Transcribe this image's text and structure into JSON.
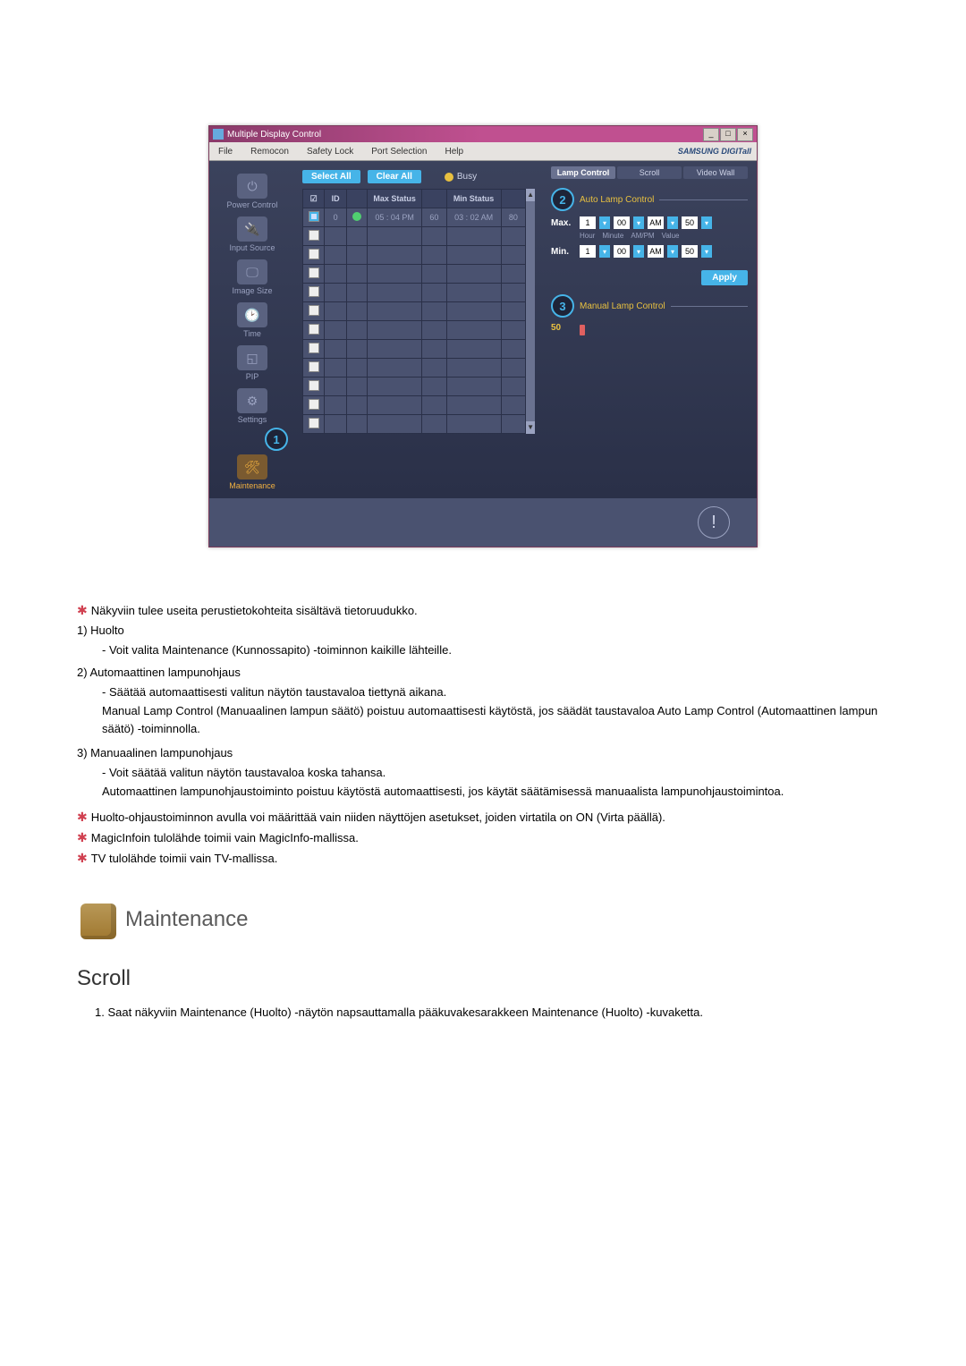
{
  "window": {
    "title": "Multiple Display Control",
    "menu": [
      "File",
      "Remocon",
      "Safety Lock",
      "Port Selection",
      "Help"
    ],
    "brand": "SAMSUNG DIGITall",
    "win_buttons": [
      "_",
      "□",
      "×"
    ]
  },
  "sidebar": {
    "items": [
      {
        "label": "Power Control"
      },
      {
        "label": "Input Source"
      },
      {
        "label": "Image Size"
      },
      {
        "label": "Time"
      },
      {
        "label": "PIP"
      },
      {
        "label": "Settings"
      },
      {
        "label": "Maintenance",
        "active": true
      }
    ],
    "callout": "1"
  },
  "toolbar": {
    "select_all": "Select All",
    "clear_all": "Clear All",
    "busy_label": "Busy"
  },
  "table": {
    "headers": {
      "chk": "☑",
      "id": "ID",
      "status_icon": "●",
      "max": "Max Status",
      "v1": "",
      "min": "Min Status",
      "v2": ""
    },
    "rows": [
      {
        "checked": true,
        "id": "0",
        "status": "green",
        "max": "05 : 04 PM",
        "v1": "60",
        "min": "03 : 02 AM",
        "v2": "80"
      },
      {
        "checked": false
      },
      {
        "checked": false
      },
      {
        "checked": false
      },
      {
        "checked": false
      },
      {
        "checked": false
      },
      {
        "checked": false
      },
      {
        "checked": false
      },
      {
        "checked": false
      },
      {
        "checked": false
      },
      {
        "checked": false
      },
      {
        "checked": false
      }
    ]
  },
  "right": {
    "tabs": [
      {
        "label": "Lamp Control",
        "active": true
      },
      {
        "label": "Scroll",
        "active": false
      },
      {
        "label": "Video Wall",
        "active": false
      }
    ],
    "auto": {
      "callout": "2",
      "title": "Auto Lamp Control",
      "rows": [
        {
          "lbl": "Max.",
          "hour": "1",
          "minute": "00",
          "ampm": "AM",
          "value": "50"
        },
        {
          "lbl": "Min.",
          "hour": "1",
          "minute": "00",
          "ampm": "AM",
          "value": "50"
        }
      ],
      "subhead": [
        "Hour",
        "Minute",
        "AM/PM",
        "Value"
      ],
      "apply": "Apply"
    },
    "manual": {
      "callout": "3",
      "title": "Manual Lamp Control",
      "value": "50"
    }
  },
  "doc": {
    "intro": "Näkyviin tulee useita perustietokohteita sisältävä tietoruudukko.",
    "n1_label": "1)  Huolto",
    "n1_body": "- Voit valita Maintenance (Kunnossapito) -toiminnon kaikille lähteille.",
    "n2_label": "2)  Automaattinen lampunohjaus",
    "n2_body1": "- Säätää automaattisesti valitun näytön taustavaloa tiettynä aikana.",
    "n2_body2": "Manual Lamp Control (Manuaalinen lampun säätö) poistuu automaattisesti käytöstä, jos säädät taustavaloa Auto Lamp Control (Automaattinen lampun säätö) -toiminnolla.",
    "n3_label": "3)  Manuaalinen lampunohjaus",
    "n3_body1": "- Voit säätää valitun näytön taustavaloa koska tahansa.",
    "n3_body2": "Automaattinen lampunohjaustoiminto poistuu käytöstä automaattisesti, jos käytät säätämisessä manuaalista lampunohjaustoimintoa.",
    "star1": "Huolto-ohjaustoiminnon avulla voi määrittää vain niiden näyttöjen asetukset, joiden virtatila on ON (Virta päällä).",
    "star2": "MagicInfoin tulolähde toimii vain MagicInfo-mallissa.",
    "star3": "TV tulolähde toimii vain TV-mallissa.",
    "maint_title": "Maintenance",
    "scroll_title": "Scroll",
    "scroll_body": "1.  Saat näkyviin Maintenance (Huolto) -näytön napsauttamalla pääkuvakesarakkeen Maintenance (Huolto) -kuvaketta."
  }
}
